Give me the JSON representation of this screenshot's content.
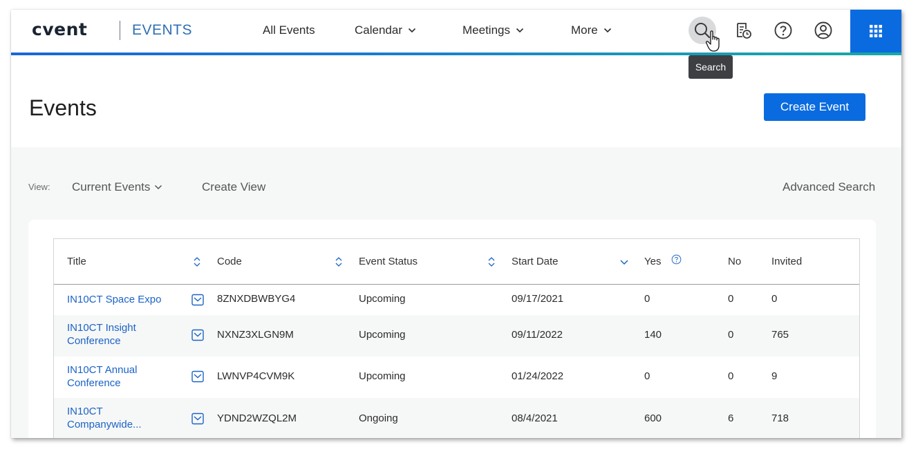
{
  "header": {
    "logo": "cvent",
    "product": "EVENTS",
    "nav": [
      {
        "label": "All Events",
        "has_chevron": false
      },
      {
        "label": "Calendar",
        "has_chevron": true
      },
      {
        "label": "Meetings",
        "has_chevron": true
      },
      {
        "label": "More",
        "has_chevron": true
      }
    ],
    "icons": [
      "search-icon",
      "report-clock-icon",
      "help-icon",
      "user-icon",
      "apps-grid-icon"
    ],
    "tooltip": "Search"
  },
  "page": {
    "title": "Events",
    "create_button": "Create Event"
  },
  "filters": {
    "view_label": "View:",
    "view_value": "Current Events",
    "create_view": "Create View",
    "advanced_search": "Advanced Search"
  },
  "table": {
    "columns": [
      "Title",
      "Code",
      "Event Status",
      "Start Date",
      "Yes",
      "No",
      "Invited"
    ],
    "rows": [
      {
        "title": [
          "IN10CT Space Expo"
        ],
        "code": "8ZNXDBWBYG4",
        "status": "Upcoming",
        "start": "09/17/2021",
        "yes": "0",
        "no": "0",
        "invited": "0"
      },
      {
        "title": [
          "IN10CT Insight",
          "Conference"
        ],
        "code": "NXNZ3XLGN9M",
        "status": "Upcoming",
        "start": "09/11/2022",
        "yes": "140",
        "no": "0",
        "invited": "765"
      },
      {
        "title": [
          "IN10CT Annual",
          "Conference"
        ],
        "code": "LWNVP4CVM9K",
        "status": "Upcoming",
        "start": "01/24/2022",
        "yes": "0",
        "no": "0",
        "invited": "9"
      },
      {
        "title": [
          "IN10CT",
          "Companywide..."
        ],
        "code": "YDND2WZQL2M",
        "status": "Ongoing",
        "start": "08/4/2021",
        "yes": "600",
        "no": "6",
        "invited": "718"
      }
    ]
  },
  "colors": {
    "brand_blue": "#0a6be0",
    "link_blue": "#1b63c6",
    "product_blue": "#2f6fb3",
    "tooltip_bg": "#3d3f43"
  }
}
